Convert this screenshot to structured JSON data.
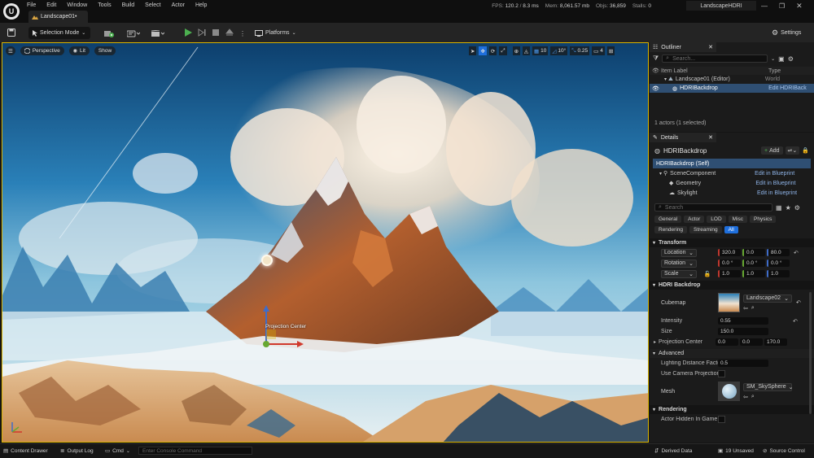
{
  "menu": [
    "File",
    "Edit",
    "Window",
    "Tools",
    "Build",
    "Select",
    "Actor",
    "Help"
  ],
  "tab": {
    "label": "Landscape01•"
  },
  "stats": {
    "fps_label": "FPS:",
    "fps": "120.2",
    "ms": "8.3 ms",
    "mem_label": "Mem:",
    "mem": "8,061.57 mb",
    "objs_label": "Objs:",
    "objs": "36,859",
    "stalls_label": "Stalls:",
    "stalls": "0"
  },
  "project_name": "LandscapeHDRI",
  "toolbar": {
    "selection_mode": "Selection Mode",
    "platforms": "Platforms",
    "settings": "Settings"
  },
  "viewport": {
    "perspective": "Perspective",
    "lit": "Lit",
    "show": "Show",
    "grid_value": "10",
    "angle_value": "10°",
    "scale_value": "0.25",
    "camera_speed": "4",
    "gizmo_label": "Projection Center"
  },
  "outliner": {
    "title": "Outliner",
    "search_placeholder": "Search...",
    "col_label": "Item Label",
    "col_type": "Type",
    "rows": [
      {
        "label": "Landscape01 (Editor)",
        "type": "World"
      },
      {
        "label": "HDRIBackdrop",
        "type": "Edit HDRIBack"
      }
    ],
    "footer": "1 actors (1 selected)"
  },
  "details": {
    "title": "Details",
    "actor_name": "HDRIBackdrop",
    "add_label": "Add",
    "components": [
      {
        "label": "HDRIBackdrop (Self)",
        "link": ""
      },
      {
        "label": "SceneComponent",
        "link": "Edit in Blueprint"
      },
      {
        "label": "Geometry",
        "link": "Edit in Blueprint"
      },
      {
        "label": "Skylight",
        "link": "Edit in Blueprint"
      }
    ],
    "search_placeholder": "Search",
    "filters_row1": [
      "General",
      "Actor",
      "LOD",
      "Misc",
      "Physics"
    ],
    "filters_row2": [
      "Rendering",
      "Streaming",
      "All"
    ],
    "transform": {
      "section": "Transform",
      "location_label": "Location",
      "location": [
        "320.0",
        "0.0",
        "80.0"
      ],
      "rotation_label": "Rotation",
      "rotation": [
        "0.0 °",
        "0.0 °",
        "0.0 °"
      ],
      "scale_label": "Scale",
      "scale": [
        "1.0",
        "1.0",
        "1.0"
      ]
    },
    "hdri": {
      "section": "HDRI Backdrop",
      "cubemap_label": "Cubemap",
      "cubemap_value": "Landscape02",
      "intensity_label": "Intensity",
      "intensity": "0.55",
      "size_label": "Size",
      "size": "150.0",
      "projection_label": "Projection Center",
      "projection": [
        "0.0",
        "0.0",
        "170.0"
      ]
    },
    "advanced": {
      "section": "Advanced",
      "lighting_label": "Lighting Distance Factor",
      "lighting": "0.5",
      "camera_proj_label": "Use Camera Projection",
      "mesh_label": "Mesh",
      "mesh_value": "SM_SkySphere"
    },
    "rendering": {
      "section": "Rendering",
      "hidden_label": "Actor Hidden In Game"
    }
  },
  "statusbar": {
    "content_drawer": "Content Drawer",
    "output_log": "Output Log",
    "cmd": "Cmd",
    "console_placeholder": "Enter Console Command",
    "derived_data": "Derived Data",
    "unsaved": "19 Unsaved",
    "source_control": "Source Control"
  },
  "colors": {
    "accent": "#1f6fdc",
    "viewport_border": "#d9b400",
    "selection": "#2f4f73"
  }
}
